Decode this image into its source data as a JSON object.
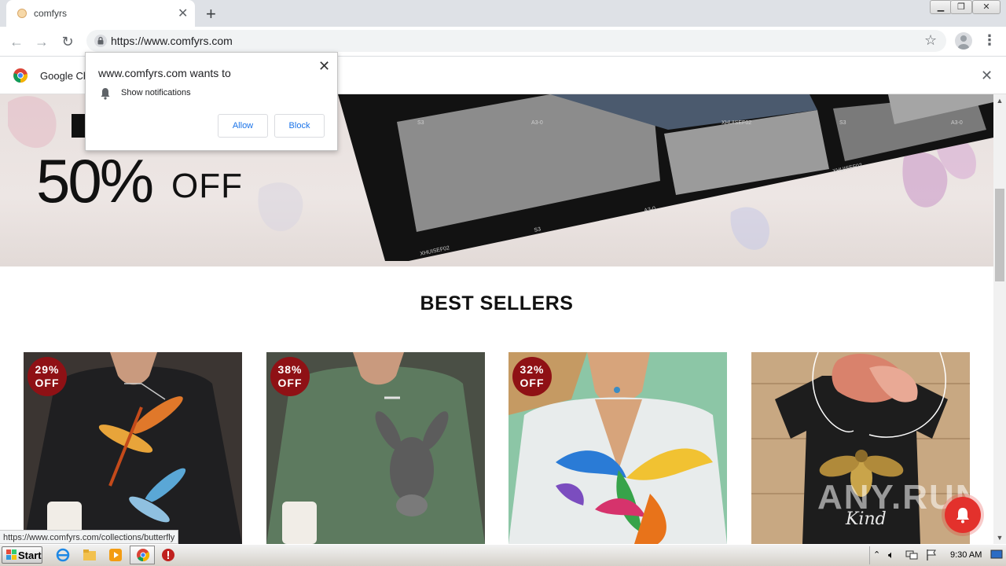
{
  "browser": {
    "tab_title": "comfyrs",
    "url": "https://www.comfyrs.com",
    "infobar_text": "Google Chrome isn't your default browser"
  },
  "popup": {
    "title": "www.comfyrs.com wants to",
    "permission": "Show notifications",
    "allow_label": "Allow",
    "block_label": "Block"
  },
  "hero": {
    "offer_percent": "50%",
    "offer_off": "OFF"
  },
  "section": {
    "title": "BEST SELLERS"
  },
  "products": [
    {
      "discount_pct": "29%",
      "discount_off": "OFF",
      "shirt_color": "#1f1f21",
      "print": "dragonfly"
    },
    {
      "discount_pct": "38%",
      "discount_off": "OFF",
      "shirt_color": "#5d7a5f",
      "print": "donkey"
    },
    {
      "discount_pct": "32%",
      "discount_off": "OFF",
      "shirt_color": "#e8ecec",
      "print": "hummingbird"
    },
    {
      "discount_pct": "",
      "discount_off": "",
      "shirt_color": "#1d1d1d",
      "print": "bee",
      "print_text": "Kind"
    }
  ],
  "status_bar_url": "https://www.comfyrs.com/collections/butterfly",
  "watermark": "ANY.RUN",
  "taskbar": {
    "start_label": "Start",
    "clock": "9:30 AM"
  },
  "colors": {
    "discount_badge": "#8f1115",
    "notify_bell": "#e3312c",
    "link_blue": "#1a73e8"
  }
}
